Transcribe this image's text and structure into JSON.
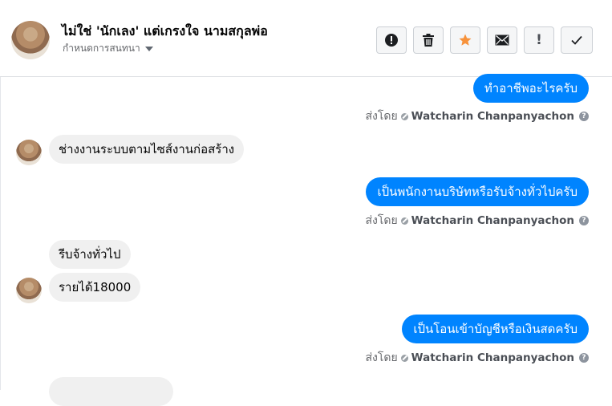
{
  "conversation": {
    "title": "ไม่ใช่ 'นักเลง' แต่เกรงใจ นามสกุลพ่อ",
    "subtitle": "กำหนดการสนทนา"
  },
  "toolbar": {
    "buttons": [
      {
        "icon": "alert-circle-icon",
        "label": ""
      },
      {
        "icon": "trash-icon",
        "label": ""
      },
      {
        "icon": "star-icon",
        "label": ""
      },
      {
        "icon": "envelope-icon",
        "label": ""
      },
      {
        "icon": "exclamation-icon",
        "label": "!"
      },
      {
        "icon": "checkmark-icon",
        "label": ""
      }
    ]
  },
  "colors": {
    "outgoing_bubble": "#0084ff",
    "incoming_bubble": "#f0f0f0",
    "star": "#f7923b"
  },
  "messages": {
    "m1": {
      "text": "ทำอาชีพอะไรครับ"
    },
    "m1_meta": {
      "prefix": "ส่งโดย",
      "sender": "Watcharin Chanpanyachon"
    },
    "m2": {
      "text": "ช่างงานระบบตามไซส์งานก่อสร้าง"
    },
    "m3": {
      "text": "เป็นพนักงานบริษัทหรือรับจ้างทั่วไปครับ"
    },
    "m3_meta": {
      "prefix": "ส่งโดย",
      "sender": "Watcharin Chanpanyachon"
    },
    "m4": {
      "text": "รีบจ้างทั่วไป"
    },
    "m5": {
      "text": "รายได้18000"
    },
    "m6": {
      "text": "เป็นโอนเข้าบัญชีหรือเงินสดครับ"
    },
    "m6_meta": {
      "prefix": "ส่งโดย",
      "sender": "Watcharin Chanpanyachon"
    }
  }
}
